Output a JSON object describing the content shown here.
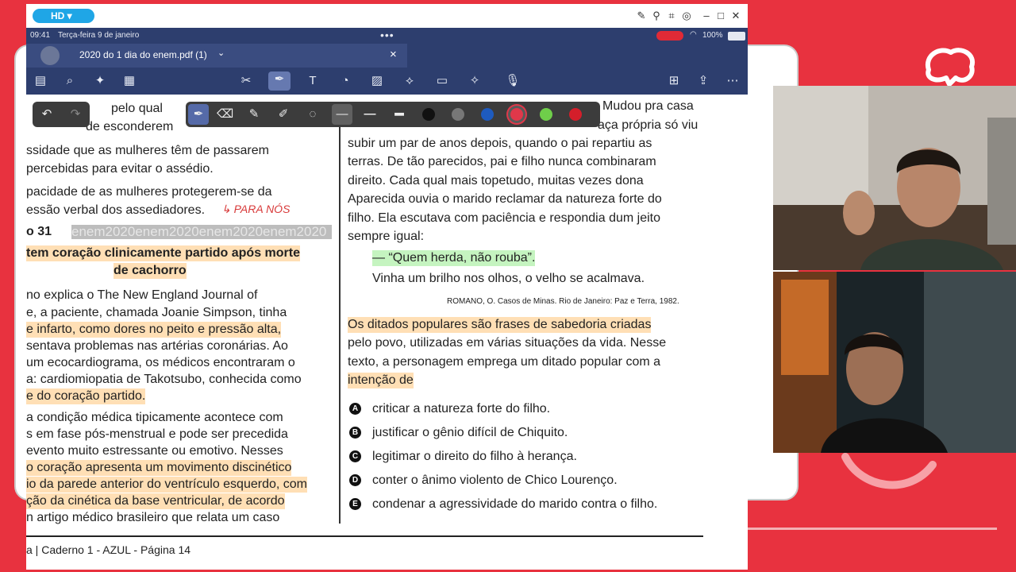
{
  "titlebar": {
    "hd_label": "HD ▾"
  },
  "statusbar": {
    "time": "09:41",
    "date": "Terça-feira 9 de janeiro",
    "battery": "100%"
  },
  "tab": {
    "filename": "2020 do 1 dia do enem.pdf (1)",
    "chevron": "⌄",
    "close": "×"
  },
  "left_column": {
    "line1": "pelo qual",
    "line2": "de esconderem",
    "line3": "ssidade que as mulheres têm de passarem",
    "line4": "percebidas para evitar o assédio.",
    "line5": "pacidade de as mulheres protegerem-se da",
    "line6": "essão verbal dos assediadores.",
    "handwriting": "↳ PARA NÓS",
    "qnum": "o 31",
    "enem_strip": "enem2020enem2020enem2020enem2020",
    "title1": "tem coração clinicamente partido após morte",
    "title2": "de cachorro",
    "p1": [
      "no explica o The New England Journal of",
      "e, a paciente, chamada Joanie Simpson, tinha",
      "e infarto, como dores no peito e pressão alta,",
      "sentava problemas nas artérias coronárias. Ao",
      "um ecocardiograma, os médicos encontraram o",
      "a: cardiomiopatia de Takotsubo, conhecida como",
      "e do coração partido."
    ],
    "p2": [
      "a condição médica tipicamente acontece com",
      "s em fase pós-menstrual e pode ser precedida",
      "evento muito estressante ou emotivo. Nesses",
      "o coração apresenta um movimento discinético",
      "io da parede anterior do ventrículo esquerdo, com",
      "ção da cinética da base ventricular, de acordo",
      "n artigo médico brasileiro que relata um caso"
    ]
  },
  "right_column": {
    "top_line_a": "Mudou pra casa",
    "top_line_b": "aça própria só viu",
    "lines": [
      "subir um par de anos depois, quando o pai repartiu as",
      "terras. De tão parecidos, pai e filho nunca combinaram",
      "direito. Cada qual mais topetudo, muitas vezes dona",
      "Aparecida ouvia o marido reclamar da natureza forte do",
      "filho. Ela escutava com paciência e respondia dum jeito",
      "sempre igual:"
    ],
    "quote": "— “Quem herda, não rouba”.",
    "line_after": "Vinha um brilho nos olhos, o velho se acalmava.",
    "citation": "ROMANO, O. Casos de Minas. Rio de Janeiro: Paz e Terra, 1982.",
    "question": [
      "Os ditados populares são frases de sabedoria criadas",
      "pelo povo, utilizadas em várias situações da vida. Nesse",
      "texto, a personagem emprega um ditado popular com a",
      "intenção de"
    ],
    "options": [
      {
        "letter": "A",
        "text": "criticar a natureza forte do filho."
      },
      {
        "letter": "B",
        "text": "justificar o gênio difícil de Chiquito."
      },
      {
        "letter": "C",
        "text": "legitimar o direito do filho à herança."
      },
      {
        "letter": "D",
        "text": "conter o ânimo violento de Chico Lourenço."
      },
      {
        "letter": "E",
        "text": "condenar a agressividade do marido contra o filho."
      }
    ]
  },
  "footer": {
    "text": "a | Caderno 1 - AZUL - Página 14"
  },
  "pen_colors": [
    "#222222",
    "#777777",
    "#1e5bbf",
    "#e0384a",
    "#6fce4a",
    "#d41e2a"
  ],
  "colors": {
    "background": "#e8323f",
    "app_bar": "#2d3e6e",
    "highlight_orange": "#ffc478",
    "highlight_green": "#96eb8c"
  }
}
